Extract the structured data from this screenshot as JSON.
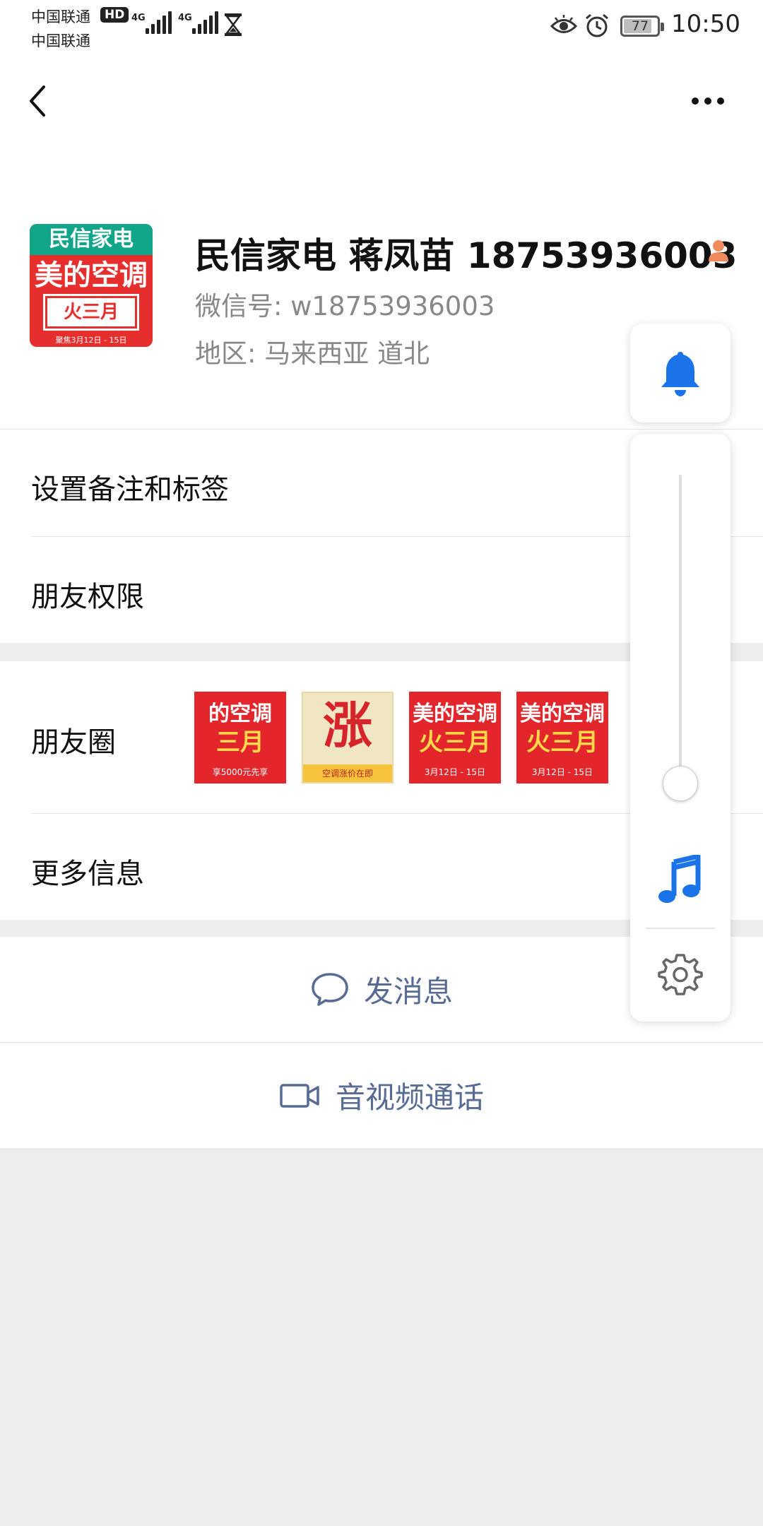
{
  "status_bar": {
    "carrier_1": "中国联通",
    "carrier_2": "中国联通",
    "hd_badge": "HD",
    "network_1": "4G",
    "network_2": "4G",
    "battery_level": "77",
    "time": "10:50"
  },
  "nav": {
    "back_icon": "chevron-left-icon",
    "more_icon": "more-horizontal-icon"
  },
  "profile": {
    "name": "民信家电 蒋凤苗 18753936003",
    "wechat_id": "微信号: w18753936003",
    "region": "地区: 马来西亚  道北",
    "avatar": {
      "top_text": "民信家电",
      "main_text": "美的空调",
      "box_text": "火三月",
      "foot_text": "聚焦3月12日 - 15日"
    }
  },
  "menu": {
    "remark_tags": "设置备注和标签",
    "friend_permissions": "朋友权限",
    "moments": "朋友圈",
    "more_info": "更多信息"
  },
  "moments_thumbs": [
    {
      "line1": "的空调",
      "line2": "三月",
      "line3": "享5000元先享",
      "bg": "#e3262b"
    },
    {
      "line1": "涨",
      "line2": "",
      "line3": "空调涨价在即",
      "bg": "#f1e6c4"
    },
    {
      "line1": "美的空调",
      "line2": "火三月",
      "line3": "3月12日 - 15日",
      "bg": "#e3262b"
    },
    {
      "line1": "美的空调",
      "line2": "火三月",
      "line3": "3月12日 - 15日",
      "bg": "#e3262b"
    }
  ],
  "actions": {
    "send_message": "发消息",
    "video_call": "音视频通话"
  },
  "volume_panel": {
    "bell_icon": "bell-icon",
    "music_icon": "music-note-icon",
    "settings_icon": "gear-icon",
    "level": 0.05,
    "accent": "#1a73e8"
  }
}
